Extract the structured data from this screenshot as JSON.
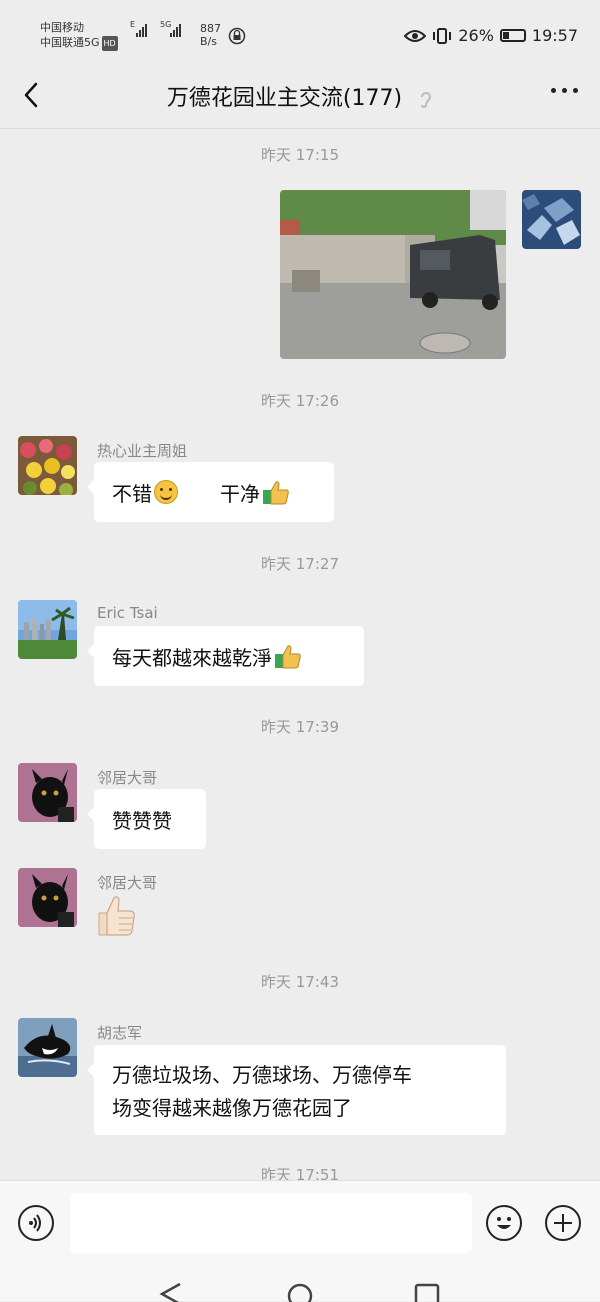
{
  "status_bar": {
    "carrier1": "中国移动",
    "carrier2": "中国联通5G",
    "hd": "HD",
    "net_e": "E",
    "net_5g": "5G",
    "speed_value": "887",
    "speed_unit": "B/s",
    "battery": "26%",
    "time": "19:57"
  },
  "header": {
    "title": "万德花园业主交流(177)"
  },
  "messages": [
    {
      "time": "昨天 17:15"
    },
    {
      "time": "昨天 17:26",
      "sender": "热心业主周姐",
      "text_a": "不错",
      "text_b": "干净"
    },
    {
      "time": "昨天 17:27",
      "sender": "Eric Tsai",
      "text": "每天都越來越乾淨"
    },
    {
      "time": "昨天 17:39",
      "sender": "邻居大哥",
      "text": "赞赞赞"
    },
    {
      "sender": "邻居大哥"
    },
    {
      "time": "昨天 17:43",
      "sender": "胡志军",
      "line1": "万德垃圾场、万德球场、万德停车",
      "line2": "场变得越来越像万德花园了"
    },
    {
      "time": "昨天 17:51"
    }
  ],
  "input_bar": {
    "placeholder": ""
  },
  "colors": {
    "background": "#ededed",
    "bubble": "#ffffff",
    "timestamp": "#999999",
    "thumbs_emoji": "#f2c14e",
    "thumbs_sleeve": "#3aa655"
  }
}
